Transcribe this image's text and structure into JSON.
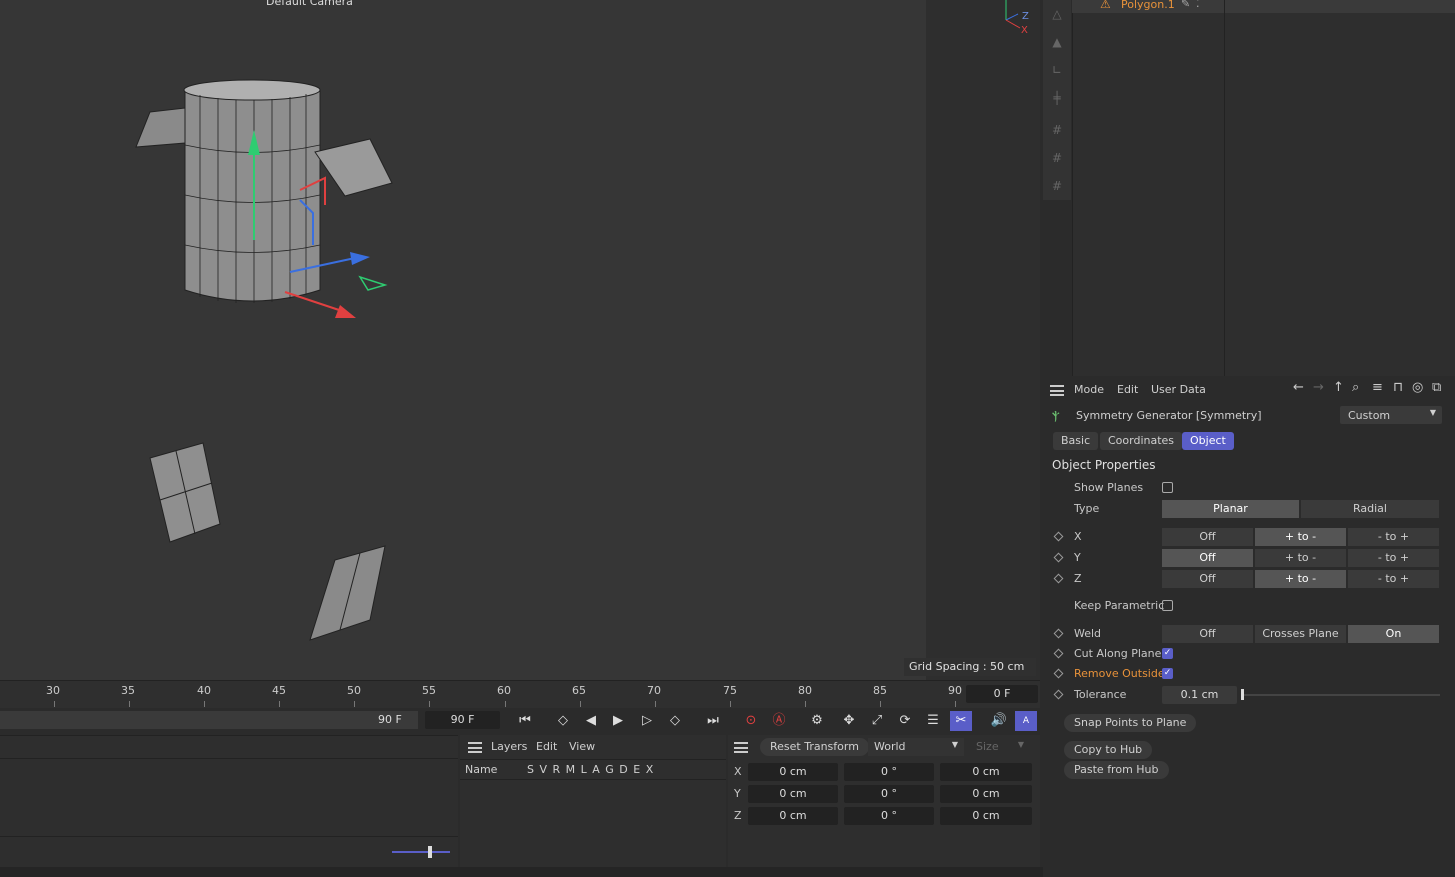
{
  "viewport": {
    "camera_label": "Default Camera",
    "grid_spacing": "Grid Spacing : 50 cm",
    "axis_labels": {
      "z": "Z",
      "x": "X"
    }
  },
  "object_manager": {
    "object_name": "Polygon.1"
  },
  "attributes": {
    "menu": {
      "mode": "Mode",
      "edit": "Edit",
      "user_data": "User Data"
    },
    "header_title": "Symmetry Generator [Symmetry]",
    "preset": "Custom",
    "tabs": [
      {
        "label": "Basic"
      },
      {
        "label": "Coordinates"
      },
      {
        "label": "Object"
      }
    ],
    "section_title": "Object Properties",
    "show_planes": "Show Planes",
    "type_label": "Type",
    "type_options": {
      "planar": "Planar",
      "radial": "Radial"
    },
    "axis_rows": [
      {
        "label": "X",
        "off": "Off",
        "pos": "+ to -",
        "neg": "- to +"
      },
      {
        "label": "Y",
        "off": "Off",
        "pos": "+ to -",
        "neg": "- to +"
      },
      {
        "label": "Z",
        "off": "Off",
        "pos": "+ to -",
        "neg": "- to +"
      }
    ],
    "keep_parametric": "Keep Parametric",
    "weld_label": "Weld",
    "weld_options": {
      "off": "Off",
      "crosses": "Crosses Plane",
      "on": "On"
    },
    "cut_along_plane": "Cut Along Plane",
    "remove_outside": "Remove Outside",
    "tolerance_label": "Tolerance",
    "tolerance_value": "0.1 cm",
    "snap_points": "Snap Points to Plane",
    "copy_hub": "Copy to Hub",
    "paste_hub": "Paste from Hub"
  },
  "timeline": {
    "ticks": [
      "30",
      "35",
      "40",
      "45",
      "50",
      "55",
      "60",
      "65",
      "70",
      "75",
      "80",
      "85",
      "90"
    ],
    "current_frame": "0 F",
    "end_frame_left": "90 F",
    "end_frame_field": "90 F"
  },
  "layers": {
    "menu": {
      "layers": "Layers",
      "edit": "Edit",
      "view": "View"
    },
    "name_col": "Name",
    "flags": "S V R M L A G D E X"
  },
  "coordinates": {
    "reset": "Reset Transform",
    "space": "World",
    "size": "Size",
    "rows": [
      {
        "axis": "X",
        "pos": "0 cm",
        "rot": "0 °",
        "size": "0 cm"
      },
      {
        "axis": "Y",
        "pos": "0 cm",
        "rot": "0 °",
        "size": "0 cm"
      },
      {
        "axis": "Z",
        "pos": "0 cm",
        "rot": "0 °",
        "size": "0 cm"
      }
    ]
  }
}
